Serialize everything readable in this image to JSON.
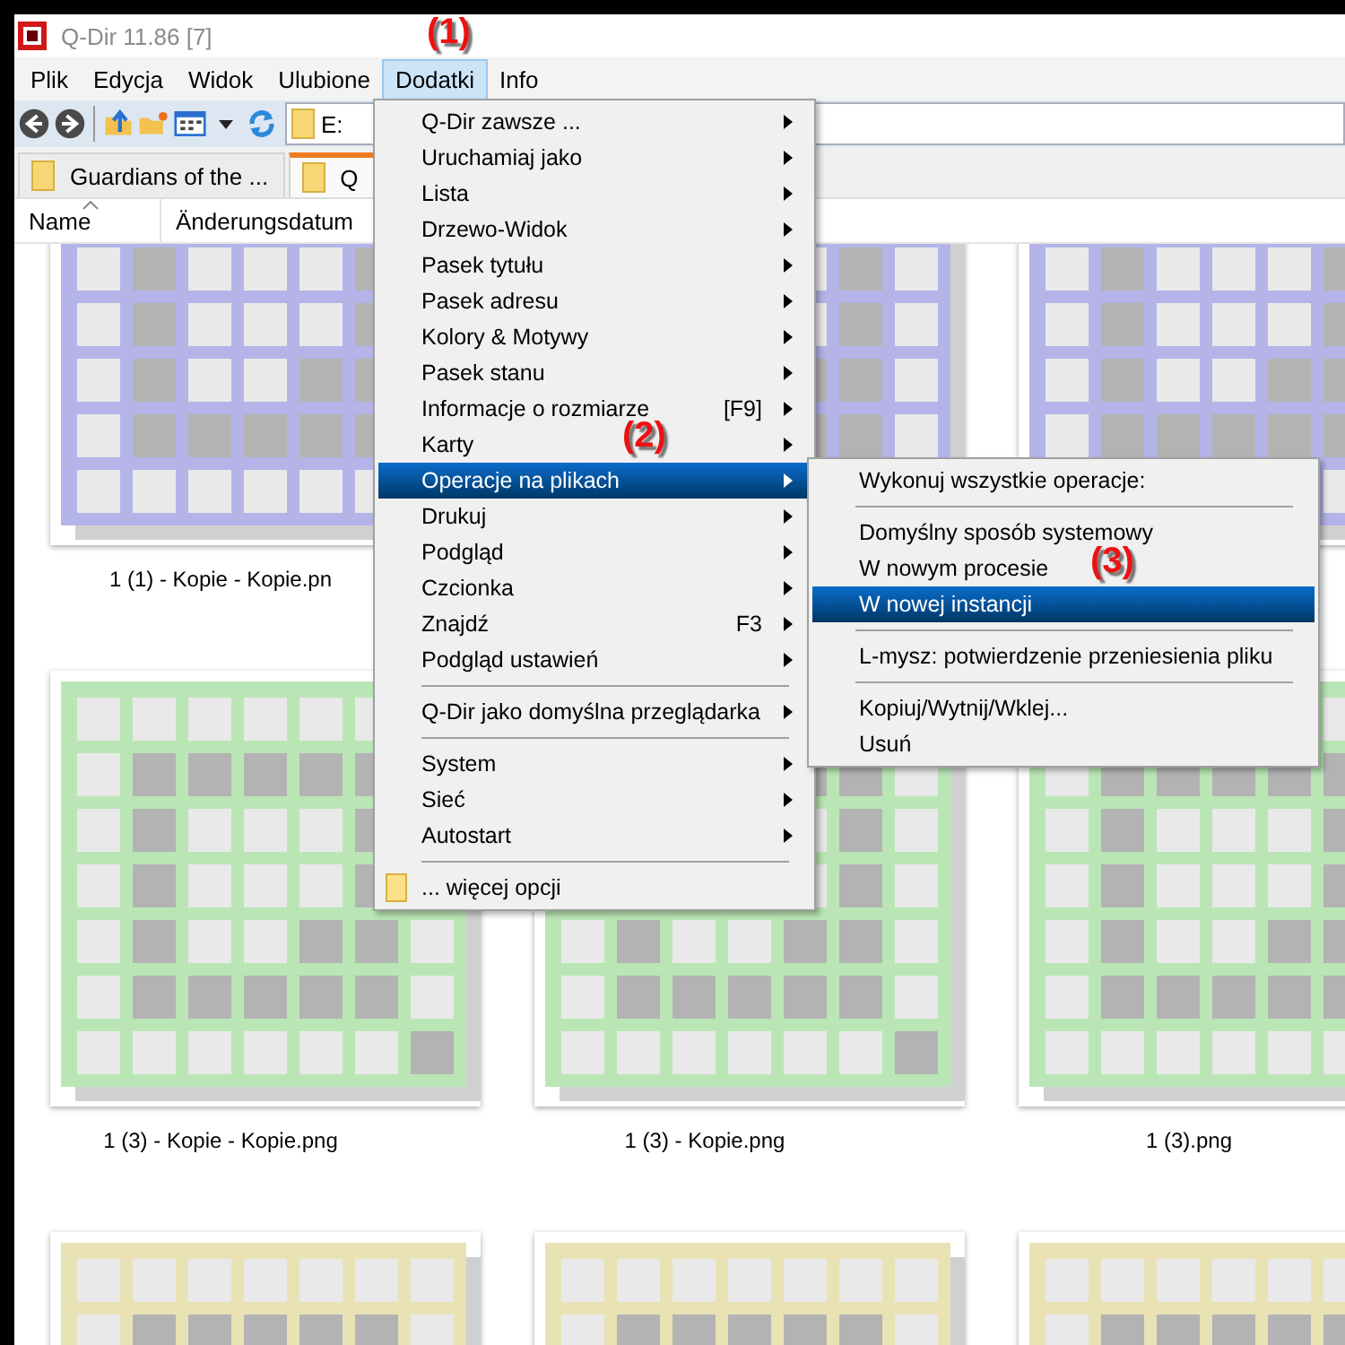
{
  "window": {
    "title": "Q-Dir 11.86 [7]"
  },
  "menu_bar": [
    {
      "label": "Plik",
      "selected": false
    },
    {
      "label": "Edycja",
      "selected": false
    },
    {
      "label": "Widok",
      "selected": false
    },
    {
      "label": "Ulubione",
      "selected": false
    },
    {
      "label": "Dodatki",
      "selected": true
    },
    {
      "label": "Info",
      "selected": false
    }
  ],
  "address_bar": {
    "value": "E:"
  },
  "tabs": [
    {
      "label": "Guardians of the ...",
      "selected": false
    },
    {
      "label": "Q",
      "selected": true
    }
  ],
  "columns": [
    {
      "label": "Name",
      "sorted": true
    },
    {
      "label": "Änderungsdatum",
      "sorted": false
    }
  ],
  "files": [
    {
      "name": "1 (1) - Kopie - Kopie.pn",
      "color": "#b4b4e8"
    },
    {
      "color": "#b4b4e8"
    },
    {
      "color": "#b4b4e8"
    },
    {
      "name": "1 (3) - Kopie - Kopie.png",
      "color": "#bae6b5"
    },
    {
      "name": "1 (3) - Kopie.png",
      "color": "#bae6b5"
    },
    {
      "name": "1 (3).png",
      "color": "#bae6b5"
    },
    {
      "color": "#e9e2b5"
    },
    {
      "color": "#e9e2b5"
    },
    {
      "color": "#e9e2b5"
    }
  ],
  "dropdown_menu": [
    {
      "kind": "item",
      "label": "Q-Dir zawsze ...",
      "submenu": true,
      "selected": false
    },
    {
      "kind": "item",
      "label": "Uruchamiaj jako",
      "submenu": true,
      "selected": false
    },
    {
      "kind": "item",
      "label": "Lista",
      "submenu": true,
      "selected": false
    },
    {
      "kind": "item",
      "label": "Drzewo-Widok",
      "submenu": true,
      "selected": false
    },
    {
      "kind": "item",
      "label": "Pasek tytułu",
      "submenu": true,
      "selected": false
    },
    {
      "kind": "item",
      "label": "Pasek adresu",
      "submenu": true,
      "selected": false
    },
    {
      "kind": "item",
      "label": "Kolory & Motywy",
      "submenu": true,
      "selected": false
    },
    {
      "kind": "item",
      "label": "Pasek stanu",
      "submenu": true,
      "selected": false
    },
    {
      "kind": "item",
      "label": "Informacje o rozmiarze",
      "shortcut": "[F9]",
      "submenu": true,
      "selected": false
    },
    {
      "kind": "item",
      "label": "Karty",
      "submenu": true,
      "selected": false
    },
    {
      "kind": "item",
      "label": "Operacje na plikach",
      "submenu": true,
      "selected": true
    },
    {
      "kind": "item",
      "label": "Drukuj",
      "submenu": true,
      "selected": false
    },
    {
      "kind": "item",
      "label": "Podgląd",
      "submenu": true,
      "selected": false
    },
    {
      "kind": "item",
      "label": "Czcionka",
      "submenu": true,
      "selected": false
    },
    {
      "kind": "item",
      "label": "Znajdź",
      "shortcut": "F3",
      "submenu": true,
      "selected": false
    },
    {
      "kind": "item",
      "label": "Podgląd ustawień",
      "submenu": true,
      "selected": false
    },
    {
      "kind": "separator"
    },
    {
      "kind": "item",
      "label": "Q-Dir jako domyślna przeglądarka",
      "submenu": true,
      "selected": false
    },
    {
      "kind": "separator"
    },
    {
      "kind": "item",
      "label": "System",
      "submenu": true,
      "selected": false
    },
    {
      "kind": "item",
      "label": "Sieć",
      "submenu": true,
      "selected": false
    },
    {
      "kind": "item",
      "label": "Autostart",
      "submenu": true,
      "selected": false
    },
    {
      "kind": "separator"
    },
    {
      "kind": "folder-item",
      "label": "... więcej opcji",
      "submenu": false,
      "selected": false
    }
  ],
  "submenu": [
    {
      "kind": "item",
      "label": "Wykonuj wszystkie operacje:",
      "selected": false
    },
    {
      "kind": "separator"
    },
    {
      "kind": "item",
      "label": "Domyślny sposób systemowy",
      "selected": false
    },
    {
      "kind": "item",
      "label": "W nowym procesie",
      "selected": false
    },
    {
      "kind": "item",
      "label": "W nowej instancji",
      "selected": true
    },
    {
      "kind": "separator"
    },
    {
      "kind": "item",
      "label": "L-mysz: potwierdzenie przeniesienia pliku",
      "selected": false
    },
    {
      "kind": "separator"
    },
    {
      "kind": "item",
      "label": "Kopiuj/Wytnij/Wklej...",
      "selected": false
    },
    {
      "kind": "item",
      "label": "Usuń",
      "selected": false
    }
  ],
  "annotations": [
    "(1)",
    "(2)",
    "(3)"
  ]
}
